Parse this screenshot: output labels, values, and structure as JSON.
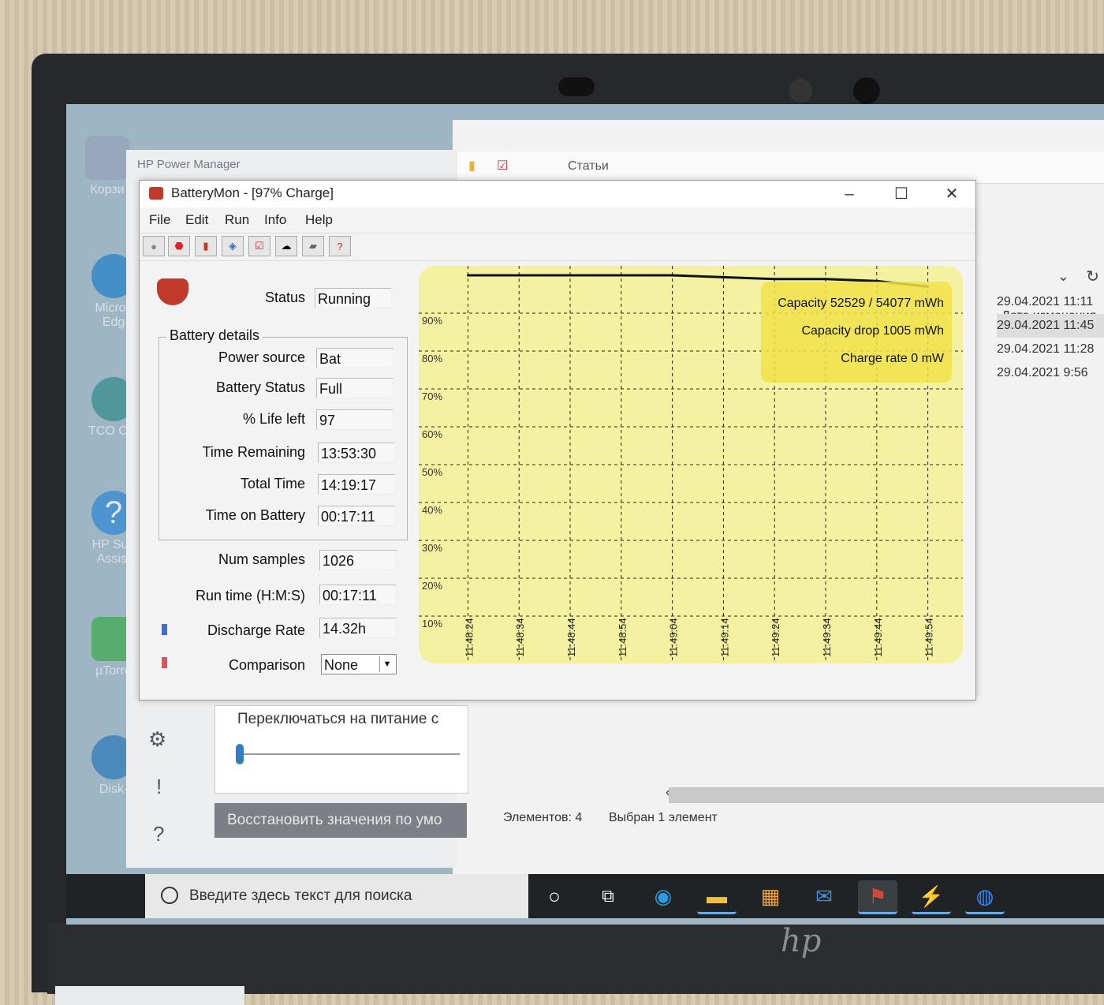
{
  "desktop": {
    "icons": [
      {
        "label": "Корзи"
      },
      {
        "label": "Micros Edg"
      },
      {
        "label": "TCO Cer"
      },
      {
        "label": "HP Sup Assist"
      },
      {
        "label": "µTorre"
      },
      {
        "label": "Disk-"
      }
    ]
  },
  "hp_power_manager": {
    "title": "HP Power Manager",
    "switch_label": "Переключаться на питание с",
    "restore_button": "Восстановить значения по умо"
  },
  "explorer": {
    "toolbar_label": "Статьи",
    "column_header": "Дата изменения",
    "dates": [
      "29.04.2021 11:11",
      "29.04.2021 11:45",
      "29.04.2021 11:28",
      "29.04.2021 9:56"
    ],
    "items_count": "Элементов: 4",
    "selected": "Выбран 1 элемент"
  },
  "taskbar": {
    "search_placeholder": "Введите здесь текст для поиска"
  },
  "batterymon": {
    "title": "BatteryMon - [97% Charge]",
    "menu": [
      "File",
      "Edit",
      "Run",
      "Info",
      "Help"
    ],
    "status_label": "Status",
    "status_value": "Running",
    "battery_details_title": "Battery details",
    "details": [
      {
        "label": "Power source",
        "value": "Bat"
      },
      {
        "label": "Battery Status",
        "value": "Full"
      },
      {
        "label": "% Life left",
        "value": "97"
      },
      {
        "label": "Time Remaining",
        "value": "13:53:30"
      },
      {
        "label": "Total Time",
        "value": "14:19:17"
      },
      {
        "label": "Time on Battery",
        "value": "00:17:11"
      }
    ],
    "num_samples_label": "Num samples",
    "num_samples_value": "1026",
    "run_time_label": "Run time (H:M:S)",
    "run_time_value": "00:17:11",
    "discharge_rate_label": "Discharge Rate",
    "discharge_rate_value": "14.32h",
    "comparison_label": "Comparison",
    "comparison_value": "None",
    "discharge_color": "#3b6fd8",
    "comparison_color": "#e0505a"
  },
  "chart_data": {
    "type": "line",
    "x": [
      "11:48:24",
      "11:48:34",
      "11:48:44",
      "11:48:54",
      "11:49:04",
      "11:49:14",
      "11:49:24",
      "11:49:34",
      "11:49:44",
      "11:49:54"
    ],
    "series": [
      {
        "values": [
          100,
          100,
          100,
          100,
          100,
          99.5,
          99,
          99,
          98.5,
          97
        ]
      }
    ],
    "ylim": [
      0,
      100
    ],
    "y_ticks": [
      "90%",
      "80%",
      "70%",
      "60%",
      "50%",
      "40%",
      "30%",
      "20%",
      "10%"
    ],
    "grid": true,
    "annotations": [
      "Capacity 52529 / 54077 mWh",
      "Capacity drop 1005 mWh",
      "Charge rate 0 mW"
    ],
    "background": "#f4f2a0",
    "line_color": "#111111",
    "annotation_bg": "#f0e24a"
  }
}
